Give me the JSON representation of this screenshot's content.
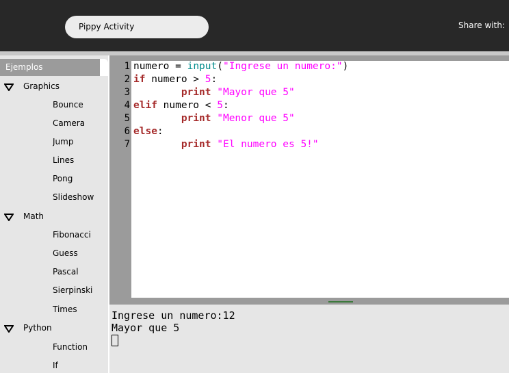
{
  "toolbar": {
    "activity_title": "Pippy Activity",
    "share_label": "Share with:"
  },
  "sidebar": {
    "header": "Ejemplos",
    "categories": [
      {
        "label": "Graphics",
        "items": [
          "Bounce",
          "Camera",
          "Jump",
          "Lines",
          "Pong",
          "Slideshow"
        ]
      },
      {
        "label": "Math",
        "items": [
          "Fibonacci",
          "Guess",
          "Pascal",
          "Sierpinski",
          "Times"
        ]
      },
      {
        "label": "Python",
        "items": [
          "Function",
          "If"
        ]
      }
    ]
  },
  "editor": {
    "line_numbers": [
      "1",
      "2",
      "3",
      "4",
      "5",
      "6",
      "7"
    ],
    "code": {
      "l1_var": "numero",
      "l1_eq": " = ",
      "l1_fn": "input",
      "l1_open": "(",
      "l1_str": "\"Ingrese un numero:\"",
      "l1_close": ")",
      "l2_kw": "if",
      "l2_rest": " numero > ",
      "l2_num": "5",
      "l2_colon": ":",
      "l3_indent": "        ",
      "l3_kw": "print",
      "l3_str": " \"Mayor que 5\"",
      "l4_kw": "elif",
      "l4_rest": " numero < ",
      "l4_num": "5",
      "l4_colon": ":",
      "l5_indent": "        ",
      "l5_kw": "print",
      "l5_str": " \"Menor que 5\"",
      "l6_kw": "else",
      "l6_colon": ":",
      "l7_indent": "        ",
      "l7_kw": "print",
      "l7_str": " \"El numero es 5!\""
    }
  },
  "output": {
    "lines": [
      "Ingrese un numero:12",
      "Mayor que 5"
    ]
  },
  "colors": {
    "toolbar_bg": "#282828",
    "keyword": "#a52a2a",
    "string": "#ff00ff",
    "builtin": "#008b8b"
  }
}
